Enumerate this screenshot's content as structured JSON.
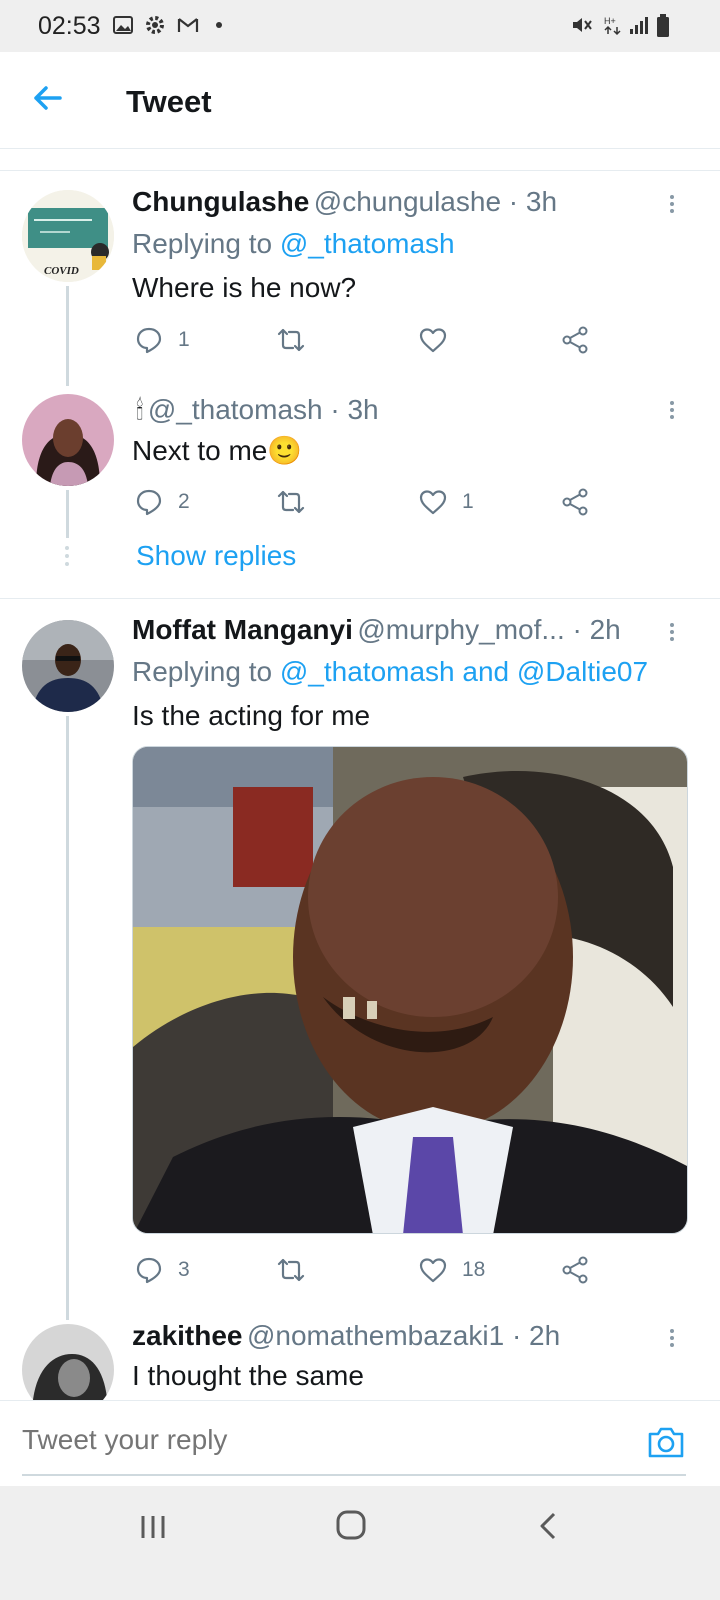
{
  "status_bar": {
    "time": "02:53"
  },
  "header": {
    "title": "Tweet"
  },
  "tweets": [
    {
      "name": "Chungulashe",
      "handle": "@chungulashe · 3h",
      "replying_prefix": "Replying to ",
      "replying_to": "@_thatomash",
      "text": "Where is he now?",
      "actions": {
        "reply_count": "1",
        "retweet_count": "",
        "like_count": ""
      },
      "avatar_text": "COVID"
    },
    {
      "name": "🕯",
      "handle": "@_thatomash · 3h",
      "text": "Next to me🙂",
      "actions": {
        "reply_count": "2",
        "retweet_count": "",
        "like_count": "1"
      }
    },
    {
      "name": "Moffat Manganyi",
      "handle": "@murphy_mof... · 2h",
      "replying_prefix": "Replying to ",
      "replying_to": "@_thatomash and @Daltie07",
      "text": "Is the acting for me",
      "actions": {
        "reply_count": "3",
        "retweet_count": "",
        "like_count": "18"
      }
    },
    {
      "name": "zakithee",
      "handle": "@nomathembazaki1 · 2h",
      "text": "I thought the same"
    }
  ],
  "show_replies": "Show replies",
  "reply_bar": {
    "placeholder": "Tweet your reply"
  },
  "colors": {
    "accent": "#1da1f2",
    "secondary_text": "#657786",
    "separator": "#e6ecf0"
  }
}
